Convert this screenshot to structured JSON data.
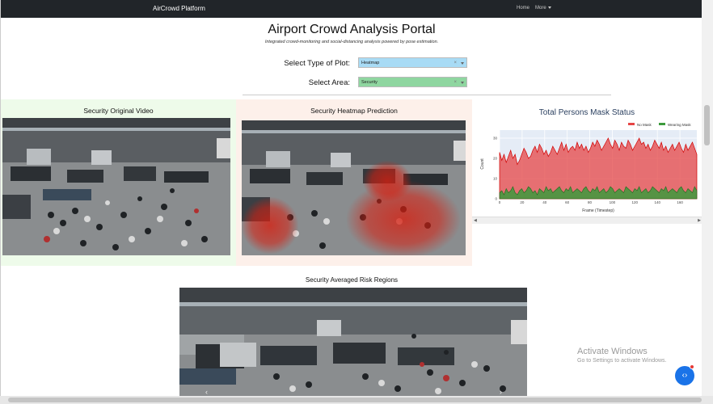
{
  "nav": {
    "brand": "AirCrowd Platform",
    "home": "Home",
    "more": "More"
  },
  "header": {
    "title": "Airport Crowd Analysis Portal",
    "subtitle": "Integrated crowd-monitoring and social-distancing analysis powered by pose estimation."
  },
  "controls": {
    "plot_label": "Select Type of Plot:",
    "plot_value": "Heatmap",
    "area_label": "Select Area:",
    "area_value": "Security",
    "clear_symbol": "×"
  },
  "panels": {
    "original": "Security Original Video",
    "heatmap": "Security Heatmap Prediction",
    "risk": "Security Averaged Risk Regions"
  },
  "mask_chart": {
    "title": "Total Persons Mask Status",
    "legend_no_mask": "No Mask",
    "legend_wearing": "Wearing Mask",
    "ylabel": "Count",
    "xlabel": "Frame (Timestep)",
    "color_no_mask": "#e64545",
    "color_wearing": "#3c9a3c"
  },
  "chart_data": {
    "type": "area",
    "title": "Total Persons Mask Status",
    "xlabel": "Frame (Timestep)",
    "ylabel": "Count",
    "xlim": [
      0,
      175
    ],
    "ylim": [
      0,
      34
    ],
    "x_ticks": [
      0,
      20,
      40,
      60,
      80,
      100,
      120,
      140,
      160
    ],
    "y_ticks": [
      0,
      10,
      20,
      30
    ],
    "legend": "top-right",
    "series": [
      {
        "name": "No Mask",
        "color": "#e64545",
        "values": [
          23,
          19,
          22,
          18,
          21,
          24,
          20,
          22,
          17,
          19,
          22,
          25,
          23,
          20,
          21,
          24,
          26,
          23,
          27,
          25,
          22,
          24,
          21,
          23,
          26,
          24,
          22,
          25,
          28,
          24,
          27,
          23,
          25,
          26,
          24,
          28,
          25,
          27,
          24,
          26,
          23,
          25,
          28,
          26,
          29,
          27,
          24,
          26,
          28,
          30,
          27,
          25,
          29,
          27,
          24,
          28,
          26,
          25,
          29,
          27,
          24,
          26,
          28,
          30,
          27,
          28,
          25,
          27,
          24,
          26,
          29,
          27,
          25,
          28,
          24,
          26,
          23,
          25,
          27,
          24,
          26,
          28,
          25,
          23,
          27,
          24,
          26,
          28,
          25,
          22
        ]
      },
      {
        "name": "Wearing Mask",
        "color": "#3c9a3c",
        "values": [
          3,
          4,
          2,
          5,
          3,
          4,
          6,
          3,
          2,
          4,
          5,
          3,
          4,
          6,
          5,
          3,
          4,
          2,
          5,
          4,
          3,
          6,
          4,
          5,
          3,
          4,
          5,
          6,
          4,
          3,
          5,
          4,
          6,
          3,
          4,
          5,
          4,
          3,
          5,
          6,
          4,
          3,
          5,
          4,
          6,
          3,
          4,
          5,
          3,
          4,
          6,
          5,
          3,
          4,
          5,
          4,
          3,
          6,
          5,
          4,
          3,
          5,
          4,
          6,
          3,
          4,
          5,
          3,
          4,
          6,
          5,
          4,
          3,
          5,
          4,
          6,
          3,
          4,
          5,
          4,
          3,
          5,
          6,
          4,
          3,
          5,
          4,
          3,
          6,
          4
        ]
      }
    ]
  },
  "watermark": {
    "line1": "Activate Windows",
    "line2": "Go to Settings to activate Windows."
  },
  "colors": {
    "plot_select_bg": "#a8dbf5",
    "area_select_bg": "#8fd6a0",
    "panel_original_bg": "#eefbea",
    "panel_heatmap_bg": "#fdf0ea",
    "navbar_bg": "#212529"
  }
}
